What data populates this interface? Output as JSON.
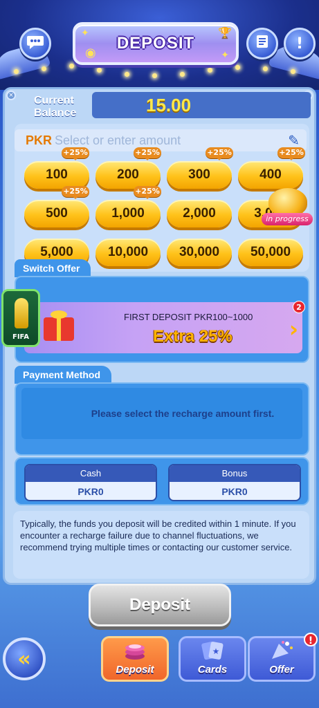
{
  "header": {
    "title": "DEPOSIT",
    "chat_icon": "chat-bubble-icon",
    "records_icon": "records-list-icon",
    "info_icon": "exclamation-icon"
  },
  "balance": {
    "label": "Current Balance",
    "value": "15.00"
  },
  "amount_input": {
    "currency": "PKR",
    "placeholder": "Select or enter amount"
  },
  "amounts": [
    {
      "label": "100",
      "bonus": "+25%"
    },
    {
      "label": "200",
      "bonus": "+25%"
    },
    {
      "label": "300",
      "bonus": "+25%"
    },
    {
      "label": "400",
      "bonus": "+25%"
    },
    {
      "label": "500",
      "bonus": "+25%"
    },
    {
      "label": "1,000",
      "bonus": "+25%"
    },
    {
      "label": "2,000",
      "bonus": ""
    },
    {
      "label": "3,000",
      "bonus": ""
    },
    {
      "label": "5,000",
      "bonus": ""
    },
    {
      "label": "10,000",
      "bonus": ""
    },
    {
      "label": "30,000",
      "bonus": ""
    },
    {
      "label": "50,000",
      "bonus": ""
    }
  ],
  "lamp_badge": "in progress",
  "switch_offer": {
    "heading": "Switch Offer",
    "title": "FIRST DEPOSIT  PKR100~1000",
    "extra": "Extra 25%",
    "count": "2"
  },
  "payment": {
    "heading": "Payment Method",
    "message": "Please select the recharge amount first.",
    "fifa_label": "FIFA"
  },
  "wallet": {
    "cash_label": "Cash",
    "cash_value": "PKR0",
    "bonus_label": "Bonus",
    "bonus_value": "PKR0"
  },
  "note": "Typically, the funds you deposit will be credited within 1 minute. If you encounter a recharge failure due to channel fluctuations, we recommend trying multiple times or contacting our customer service.",
  "deposit_button": "Deposit",
  "nav": {
    "deposit": "Deposit",
    "cards": "Cards",
    "offer": "Offer",
    "offer_badge": "!"
  },
  "colors": {
    "accent_gold": "#ffc21a",
    "panel_blue": "#3f95ea",
    "active_tab": "#f0662a"
  }
}
